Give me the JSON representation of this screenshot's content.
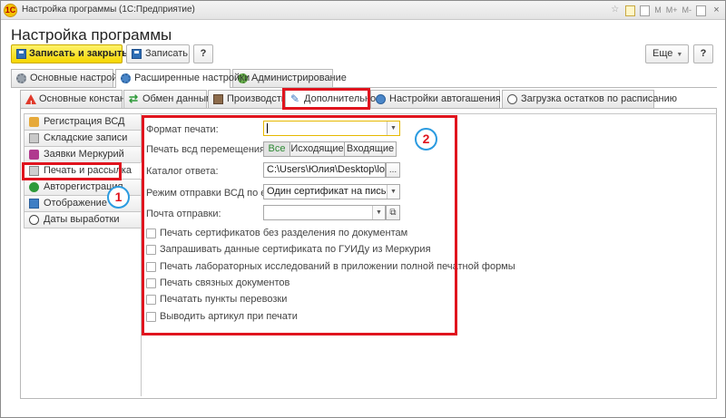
{
  "window": {
    "title": "Настройка программы (1С:Предприятие)",
    "logo": "1C",
    "controls": {
      "m": "M",
      "m_plus": "M+",
      "m_minus": "M-",
      "close": "×"
    }
  },
  "page_title": "Настройка программы",
  "toolbar": {
    "save_close_label": "Записать и закрыть",
    "save_label": "Записать",
    "help_label": "?",
    "more_label": "Еще"
  },
  "main_tabs": [
    {
      "label": "Основные настройки",
      "icon": "gear-icon"
    },
    {
      "label": "Расширенные настройки",
      "icon": "gear-blue-icon",
      "active": true
    },
    {
      "label": "Администрирование",
      "icon": "gear-green-icon"
    }
  ],
  "sub_tabs": [
    {
      "label": "Основные константы",
      "icon": "warning-icon"
    },
    {
      "label": "Обмен данными",
      "icon": "sync-icon"
    },
    {
      "label": "Производство",
      "icon": "factory-icon"
    },
    {
      "label": "Дополнительно",
      "icon": "pen-icon",
      "active": true
    },
    {
      "label": "Настройки автогашения ВСД",
      "icon": "bulb-icon"
    },
    {
      "label": "Загрузка остатков по расписанию",
      "icon": "clock-icon"
    }
  ],
  "side_list": [
    {
      "label": "Регистрация ВСД",
      "icon": "registration-icon"
    },
    {
      "label": "Складские записи",
      "icon": "warehouse-icon"
    },
    {
      "label": "Заявки Меркурий",
      "icon": "mercury-icon"
    },
    {
      "label": "Печать и рассылка",
      "icon": "printer-icon",
      "active": true
    },
    {
      "label": "Авторегистрация",
      "icon": "check-icon"
    },
    {
      "label": "Отображение",
      "icon": "monitor-icon"
    },
    {
      "label": "Даты выработки",
      "icon": "clock-icon"
    }
  ],
  "form": {
    "print_format_label": "Формат печати:",
    "print_format_value": "",
    "print_vsd_label": "Печать всд перемещения:",
    "print_vsd_options": [
      "Все",
      "Исходящие",
      "Входящие"
    ],
    "print_vsd_selected": "Все",
    "reply_dir_label": "Каталог ответа:",
    "reply_dir_value": "C:\\Users\\Юлия\\Desktop\\log\\",
    "reply_dir_btn": "...",
    "email_mode_label": "Режим отправки ВСД по email:",
    "email_mode_value": "Один сертификат на письмо",
    "mail_label": "Почта отправки:",
    "mail_value": ""
  },
  "checkboxes": [
    {
      "label": "Печать сертификатов без разделения по документам",
      "checked": false
    },
    {
      "label": "Запрашивать данные сертификата по ГУИДу из Меркурия",
      "checked": false
    },
    {
      "label": "Печать лабораторных исследований в приложении полной печатной формы",
      "checked": false
    },
    {
      "label": "Печать связных документов",
      "checked": false
    },
    {
      "label": "Печатать  пункты  перевозки",
      "checked": false
    },
    {
      "label": "Выводить артикул при печати",
      "checked": false
    }
  ],
  "annotations": {
    "marker_1": "1",
    "marker_2": "2",
    "highlight_color": "#e0141e",
    "circle_color": "#2b9be0"
  }
}
